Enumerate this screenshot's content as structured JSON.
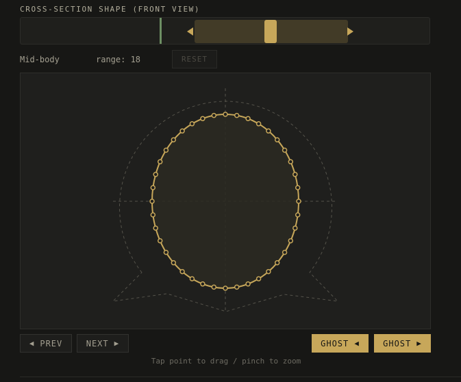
{
  "header": {
    "title": "CROSS-SECTION SHAPE (FRONT VIEW)"
  },
  "timeline": {
    "playhead_color": "#6d8f63",
    "range_color": "#423b27",
    "handle_color": "#c7a75a"
  },
  "status": {
    "position_label": "Mid-body",
    "range_label": "range: 18",
    "reset_label": "RESET"
  },
  "editor": {
    "shape": "ellipse",
    "control_point_count": 40,
    "stroke_color": "#c7a75a",
    "fill_color": "#2c2a22",
    "guide_color": "#55534b"
  },
  "nav": {
    "prev_label": "PREV",
    "next_label": "NEXT",
    "ghost_prev_label": "GHOST",
    "ghost_next_label": "GHOST"
  },
  "icons": {
    "prev": "triangle-left-icon",
    "next": "triangle-right-icon"
  },
  "hint": "Tap point to drag / pinch to zoom"
}
